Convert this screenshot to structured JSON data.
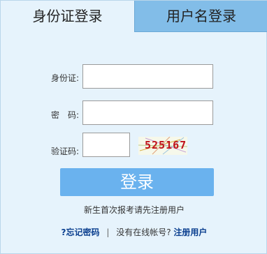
{
  "tabs": {
    "id_card_login": "身份证登录",
    "username_login": "用户名登录"
  },
  "form": {
    "id_label": "身份证:",
    "id_value": "",
    "password_label": "密　码:",
    "password_value": "",
    "captcha_label": "验证码:",
    "captcha_value": "",
    "captcha_image_text": "525167"
  },
  "actions": {
    "login_label": "登录",
    "new_student_hint": "新生首次报考请先注册用户",
    "forgot_password": "?忘记密码",
    "separator": "|",
    "no_account": "没有在线帐号?",
    "register": "注册用户"
  },
  "colors": {
    "panel_background": "#e6f3fc",
    "inactive_tab": "#82bde8",
    "login_button": "#6ab2ee",
    "link": "#0b3f8f",
    "captcha_text": "#c0121a"
  }
}
